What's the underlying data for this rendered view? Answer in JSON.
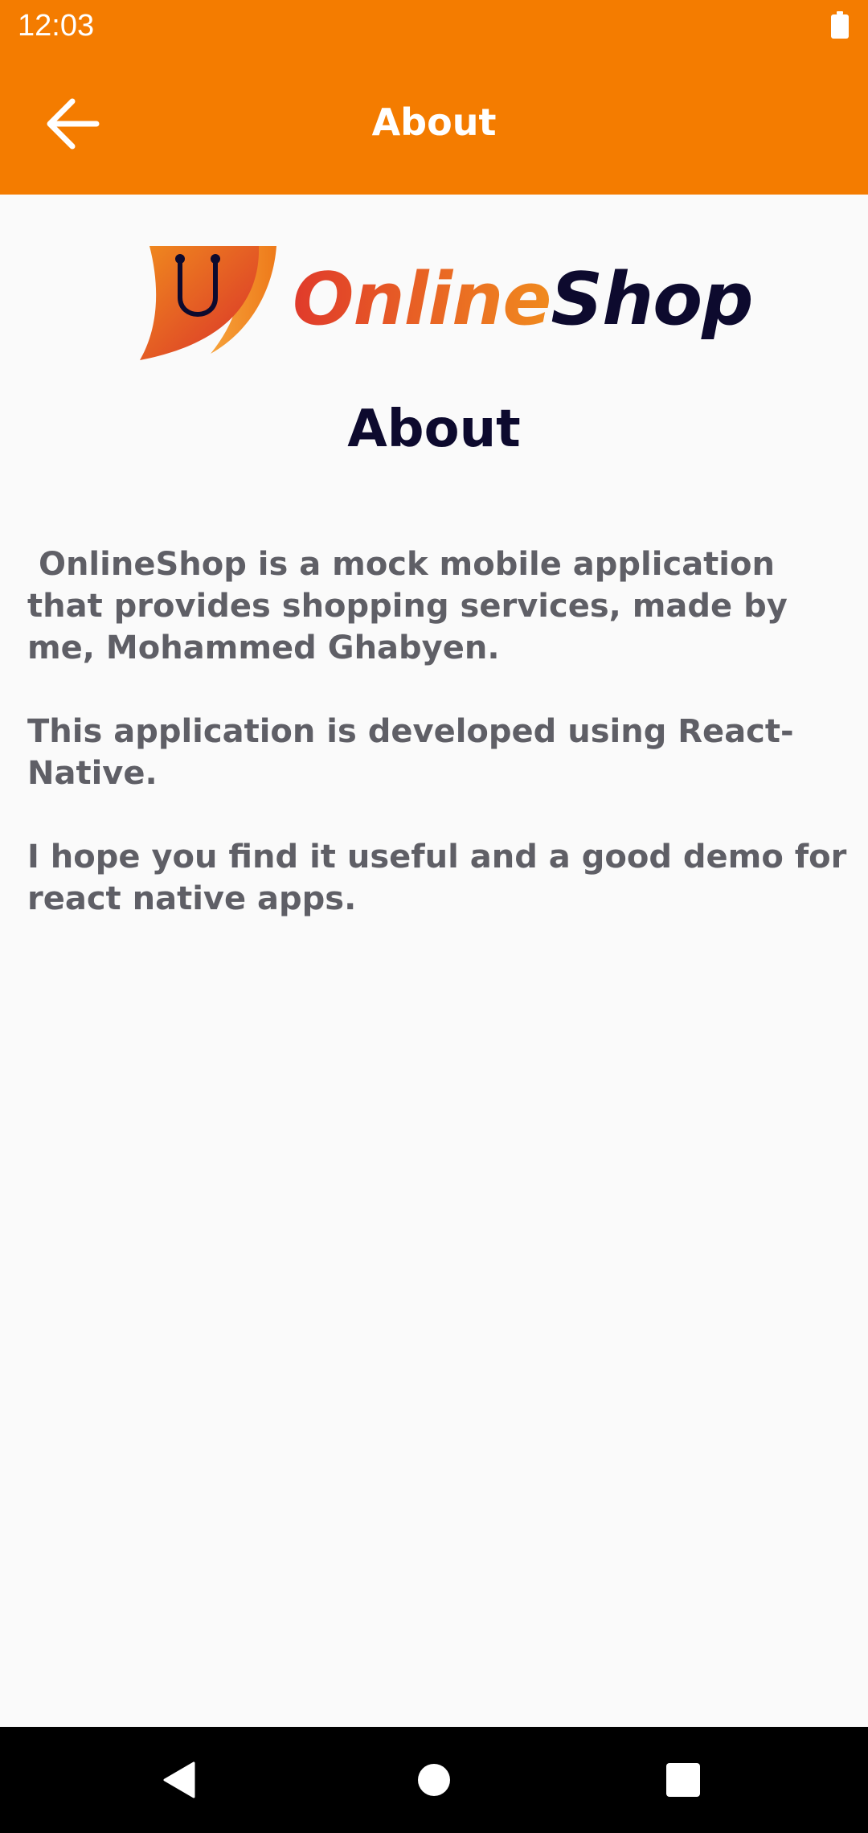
{
  "status_bar": {
    "time": "12:03",
    "battery_icon": "battery-full-icon"
  },
  "app_bar": {
    "title": "About",
    "back_icon": "arrow-left-icon"
  },
  "logo": {
    "word_part1": "Online",
    "word_part2": "Shop",
    "icon": "shopping-bag-icon",
    "colors": {
      "gradient_start": "#e03a2b",
      "gradient_end": "#f08a1e",
      "dark": "#0d0a2e"
    }
  },
  "page": {
    "heading": "About",
    "paragraphs": [
      " OnlineShop is a mock mobile application that provides shopping services, made by me, Mohammed Ghabyen.",
      "This application is developed using React-Native.",
      "I hope you find it useful and a good demo for react native apps."
    ]
  },
  "nav_bar": {
    "back_icon": "nav-back-triangle-icon",
    "home_icon": "nav-home-circle-icon",
    "recents_icon": "nav-recents-square-icon"
  },
  "colors": {
    "accent": "#f47c00",
    "text": "#5f5f66",
    "heading": "#0d0a2e",
    "background": "#fafafa"
  }
}
